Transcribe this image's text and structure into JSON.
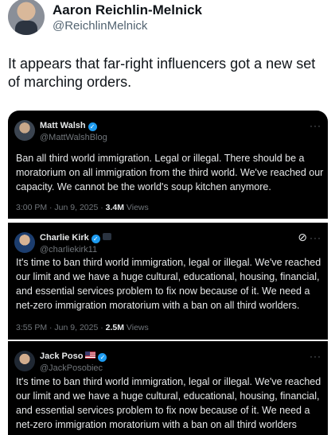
{
  "post": {
    "author_name": "Aaron Reichlin-Melnick",
    "author_handle": "@ReichlinMelnick",
    "text": "It appears that far-right influencers got a new set of marching orders."
  },
  "quotes": [
    {
      "name": "Matt Walsh",
      "handle": "@MattWalshBlog",
      "text": "Ban all third world immigration. Legal or illegal. There should be a moratorium on all immigration from the third world. We've reached our capacity. We cannot be the world's soup kitchen anymore.",
      "time": "3:00 PM · Jun 9, 2025 · ",
      "views": "3.4M",
      "views_label": " Views"
    },
    {
      "name": "Charlie Kirk",
      "handle": "@charliekirk11",
      "text": "It's time to ban third world immigration, legal or illegal. We've reached our limit and we have a huge cultural, educational, housing, financial, and essential services problem to fix now because of it. We need a net-zero immigration moratorium with a ban on all third worlders.",
      "time": "3:55 PM · Jun 9, 2025 · ",
      "views": "2.5M",
      "views_label": " Views"
    },
    {
      "name": "Jack Poso",
      "handle": "@JackPosobiec",
      "text": "It's time to ban third world immigration, legal or illegal. We've reached our limit and we have a huge cultural, educational, housing, financial, and essential services problem to fix now because of it. We need a net-zero immigration moratorium with a ban on all third worlders"
    }
  ],
  "icons": {
    "verified": "verified-badge-icon",
    "more": "more-options-icon",
    "grok": "grok-icon",
    "flag": "us-flag-icon"
  },
  "colors": {
    "card_bg": "#000000",
    "verified_blue": "#1d9bf0",
    "secondary_text": "#536471"
  }
}
